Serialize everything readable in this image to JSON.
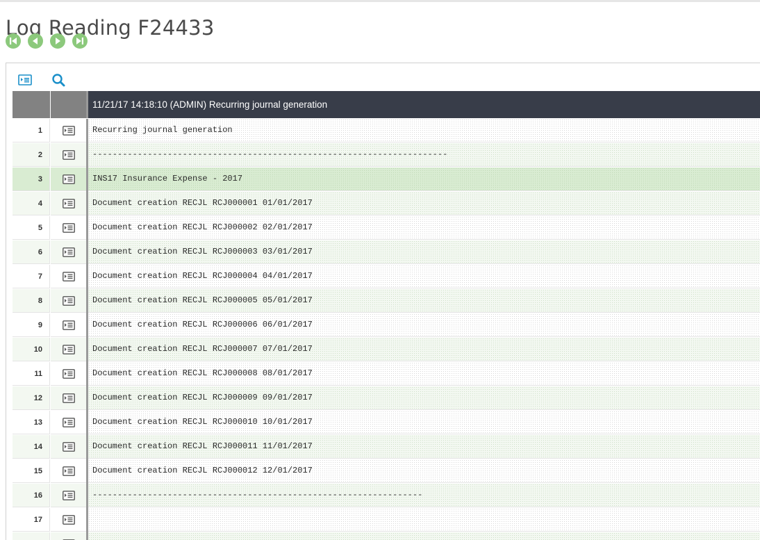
{
  "page": {
    "title": "Log Reading F24433"
  },
  "nav": {
    "first_icon": "first-record-icon",
    "prev_icon": "previous-record-icon",
    "next_icon": "next-record-icon",
    "last_icon": "last-record-icon",
    "accent": "#8cc97c"
  },
  "toolbar": {
    "detail_icon": "detail-view-icon",
    "search_icon": "search-icon",
    "accent": "#1a8fc9"
  },
  "grid": {
    "header_text": "11/21/17 14:18:10 (ADMIN) Recurring journal generation",
    "header_color": "#383d49",
    "selected_row": 3,
    "rows": [
      {
        "num": "1",
        "text": "Recurring journal generation"
      },
      {
        "num": "2",
        "text": "-----------------------------------------------------------------------"
      },
      {
        "num": "3",
        "text": "INS17 Insurance Expense - 2017"
      },
      {
        "num": "4",
        "text": "Document creation RECJL RCJ000001 01/01/2017"
      },
      {
        "num": "5",
        "text": "Document creation RECJL RCJ000002 02/01/2017"
      },
      {
        "num": "6",
        "text": "Document creation RECJL RCJ000003 03/01/2017"
      },
      {
        "num": "7",
        "text": "Document creation RECJL RCJ000004 04/01/2017"
      },
      {
        "num": "8",
        "text": "Document creation RECJL RCJ000005 05/01/2017"
      },
      {
        "num": "9",
        "text": "Document creation RECJL RCJ000006 06/01/2017"
      },
      {
        "num": "10",
        "text": "Document creation RECJL RCJ000007 07/01/2017"
      },
      {
        "num": "11",
        "text": "Document creation RECJL RCJ000008 08/01/2017"
      },
      {
        "num": "12",
        "text": "Document creation RECJL RCJ000009 09/01/2017"
      },
      {
        "num": "13",
        "text": "Document creation RECJL RCJ000010 10/01/2017"
      },
      {
        "num": "14",
        "text": "Document creation RECJL RCJ000011 11/01/2017"
      },
      {
        "num": "15",
        "text": "Document creation RECJL RCJ000012 12/01/2017"
      },
      {
        "num": "16",
        "text": "------------------------------------------------------------------"
      },
      {
        "num": "17",
        "text": ""
      },
      {
        "num": "",
        "text": ""
      }
    ]
  }
}
